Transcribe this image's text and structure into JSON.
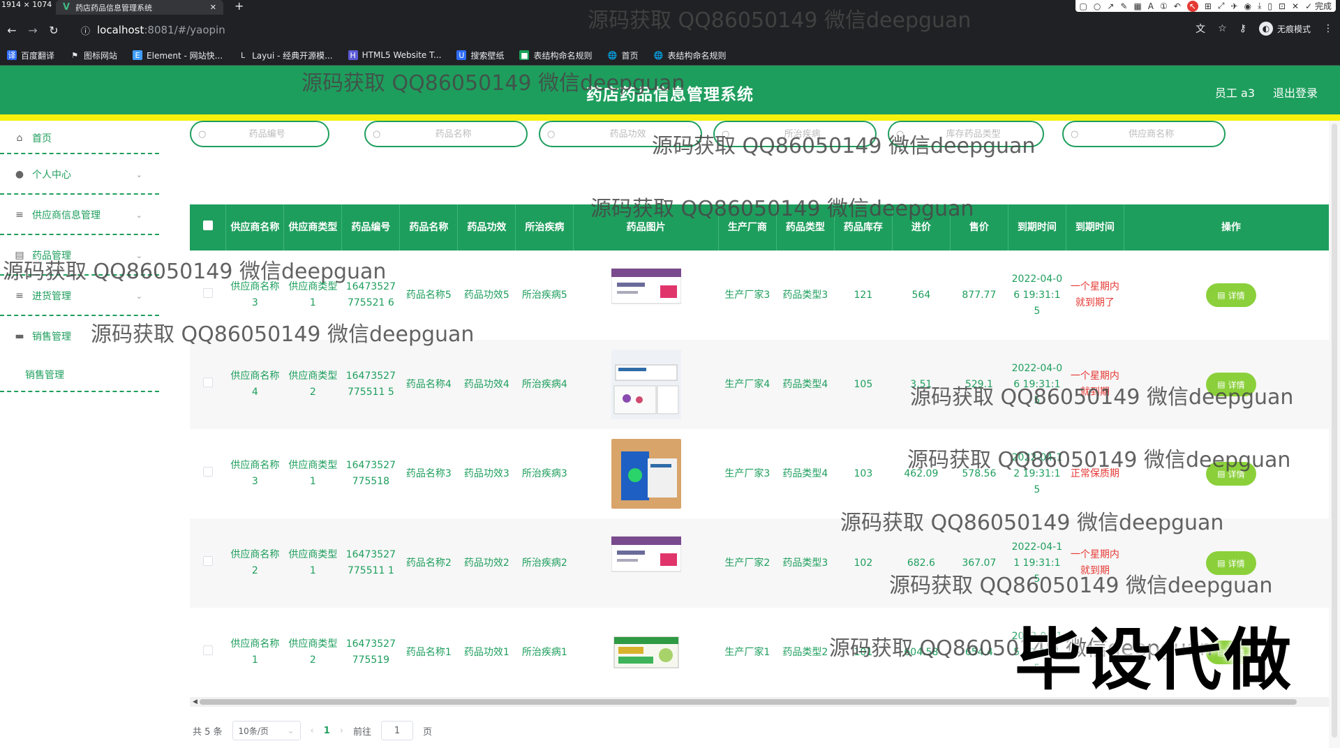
{
  "browser": {
    "size_overlay": "1914 × 1074",
    "tab_title": "药店药品信息管理系统",
    "url_host": "localhost",
    "url_path": ":8081/#/yaopin",
    "incognito": "无痕模式",
    "annotation_done": "完成",
    "bookmarks": [
      "百度翻译",
      "图标网站",
      "Element - 网站快...",
      "Layui - 经典开源模...",
      "HTML5 Website T...",
      "搜索壁纸",
      "表结构命名规则",
      "首页",
      "表结构命名规则"
    ]
  },
  "header": {
    "title": "药店药品信息管理系统",
    "user": "员工 a3",
    "logout": "退出登录"
  },
  "sidebar": {
    "items": [
      "首页",
      "个人中心",
      "供应商信息管理",
      "药品管理",
      "进货管理",
      "销售管理"
    ],
    "sub_item": "销售管理"
  },
  "search": {
    "placeholders": [
      "药品编号",
      "药品名称",
      "药品功效",
      "所治疾病",
      "库存药品类型",
      "供应商名称"
    ]
  },
  "table": {
    "headers": [
      "供应商名称",
      "供应商类型",
      "药品编号",
      "药品名称",
      "药品功效",
      "所治疾病",
      "药品图片",
      "生产厂商",
      "药品类型",
      "药品库存",
      "进价",
      "售价",
      "到期时间",
      "到期时间",
      "操作"
    ],
    "detail_label": "详情",
    "rows": [
      {
        "supplier": "供应商名称3",
        "stype": "供应商类型1",
        "code": "16473527775521 6",
        "name": "药品名称5",
        "effect": "药品功效5",
        "disease": "所治疾病5",
        "maker": "生产厂家3",
        "dtype": "药品类型3",
        "stock": "121",
        "cost": "564",
        "price": "877.77",
        "expire": "2022-04-06 19:31:15",
        "status": "一个星期内就到期了",
        "image_color": "#ffffff"
      },
      {
        "supplier": "供应商名称4",
        "stype": "供应商类型2",
        "code": "16473527775511 5",
        "name": "药品名称4",
        "effect": "药品功效4",
        "disease": "所治疾病4",
        "maker": "生产厂家4",
        "dtype": "药品类型4",
        "stock": "105",
        "cost": "3.51",
        "price": "529.1",
        "expire": "2022-04-06 19:31:15",
        "status": "一个星期内就到期",
        "image_color": "#e9eef3"
      },
      {
        "supplier": "供应商名称3",
        "stype": "供应商类型1",
        "code": "16473527775518",
        "name": "药品名称3",
        "effect": "药品功效3",
        "disease": "所治疾病3",
        "maker": "生产厂家3",
        "dtype": "药品类型4",
        "stock": "103",
        "cost": "462.09",
        "price": "578.56",
        "expire": "2022-04-12 19:31:15",
        "status": "正常保质期",
        "image_color": "#d8a46a"
      },
      {
        "supplier": "供应商名称2",
        "stype": "供应商类型1",
        "code": "16473527775511 1",
        "name": "药品名称2",
        "effect": "药品功效2",
        "disease": "所治疾病2",
        "maker": "生产厂家2",
        "dtype": "药品类型3",
        "stock": "102",
        "cost": "682.6",
        "price": "367.07",
        "expire": "2022-04-11 19:31:15",
        "status": "一个星期内就到期",
        "image_color": "#ffffff"
      },
      {
        "supplier": "供应商名称1",
        "stype": "供应商类型2",
        "code": "16473527775519",
        "name": "药品名称1",
        "effect": "药品功效1",
        "disease": "所治疾病1",
        "maker": "生产厂家1",
        "dtype": "药品类型2",
        "stock": "101",
        "cost": "604.58",
        "price": "654.4",
        "expire": "2022-04-15 19:31:15",
        "status": "",
        "image_color": "#ffffff"
      }
    ]
  },
  "pager": {
    "total": "共 5 条",
    "size": "10条/页",
    "current": "1",
    "goto_label": "前往",
    "goto_value": "1",
    "page_unit": "页"
  },
  "overlay": {
    "watermark": "源码获取 QQ86050149 微信deepguan",
    "big": "毕设代做"
  },
  "colors": {
    "primary": "#1e9e5d",
    "accent": "#f5f10c",
    "button": "#8bd03a",
    "warning": "#e53935"
  }
}
